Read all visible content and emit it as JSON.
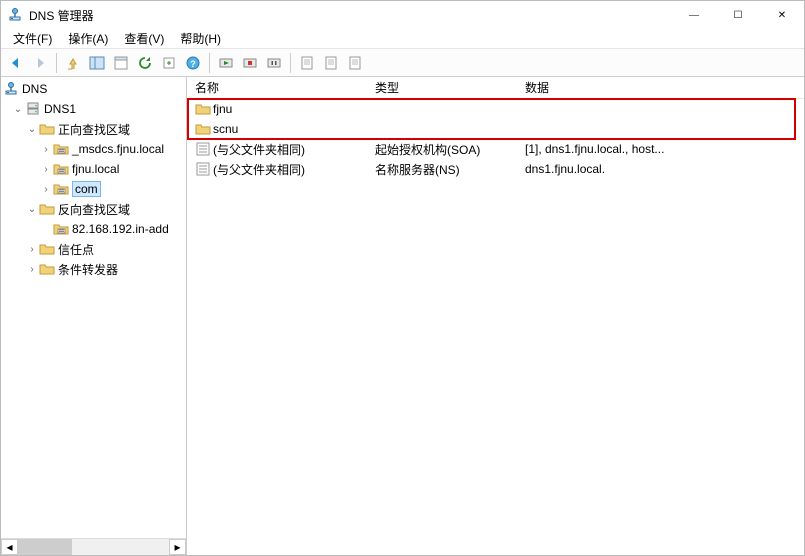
{
  "title": "DNS 管理器",
  "window_controls": {
    "min": "—",
    "max": "☐",
    "close": "✕"
  },
  "menu": [
    "文件(F)",
    "操作(A)",
    "查看(V)",
    "帮助(H)"
  ],
  "tree": {
    "root_label": "DNS",
    "server": "DNS1",
    "forward_zone_label": "正向查找区域",
    "forward_children": [
      "_msdcs.fjnu.local",
      "fjnu.local",
      "com"
    ],
    "reverse_zone_label": "反向查找区域",
    "reverse_children": [
      "82.168.192.in-add"
    ],
    "trust_points_label": "信任点",
    "conditional_label": "条件转发器"
  },
  "columns": {
    "name": "名称",
    "type": "类型",
    "data": "数据"
  },
  "rows": [
    {
      "kind": "folder",
      "name": "fjnu",
      "type": "",
      "data": ""
    },
    {
      "kind": "folder",
      "name": "scnu",
      "type": "",
      "data": ""
    },
    {
      "kind": "record",
      "name": "(与父文件夹相同)",
      "type": "起始授权机构(SOA)",
      "data": "[1], dns1.fjnu.local., host..."
    },
    {
      "kind": "record",
      "name": "(与父文件夹相同)",
      "type": "名称服务器(NS)",
      "data": "dns1.fjnu.local."
    }
  ]
}
